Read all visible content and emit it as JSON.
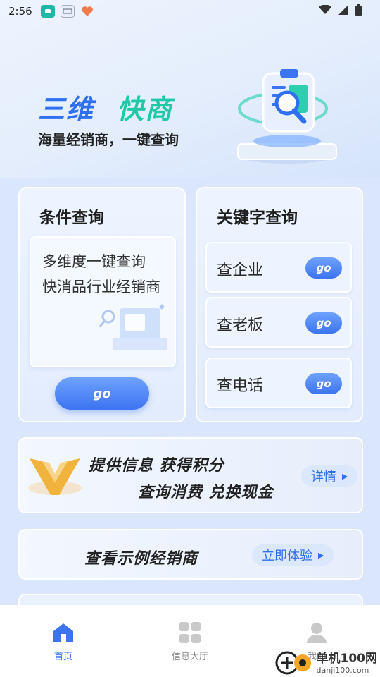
{
  "status_bar": {
    "time": "2:56"
  },
  "hero": {
    "title_part1": "三维",
    "title_part2": "快商",
    "subtitle": "海量经销商，一键查询"
  },
  "condition_card": {
    "title": "条件查询",
    "line1": "多维度一键查询",
    "line2": "快消品行业经销商",
    "go_label": "go"
  },
  "keyword_card": {
    "title": "关键字查询",
    "rows": [
      {
        "label": "查企业",
        "go_label": "go"
      },
      {
        "label": "查老板",
        "go_label": "go"
      },
      {
        "label": "查电话",
        "go_label": "go"
      }
    ]
  },
  "points_banner": {
    "line1": "提供信息  获得积分",
    "line2": "查询消费  兑换现金",
    "button_label": "详情"
  },
  "example_banner": {
    "text": "查看示例经销商",
    "button_label": "立即体验"
  },
  "bottom_nav": {
    "items": [
      {
        "label": "首页"
      },
      {
        "label": "信息大厅"
      },
      {
        "label": "我的"
      }
    ]
  },
  "watermark": {
    "name": "单机100网",
    "url": "danji100.com"
  },
  "colors": {
    "primary_blue": "#2f6ff2",
    "accent_teal": "#1ec9a8",
    "gold": "#f0b43c"
  }
}
